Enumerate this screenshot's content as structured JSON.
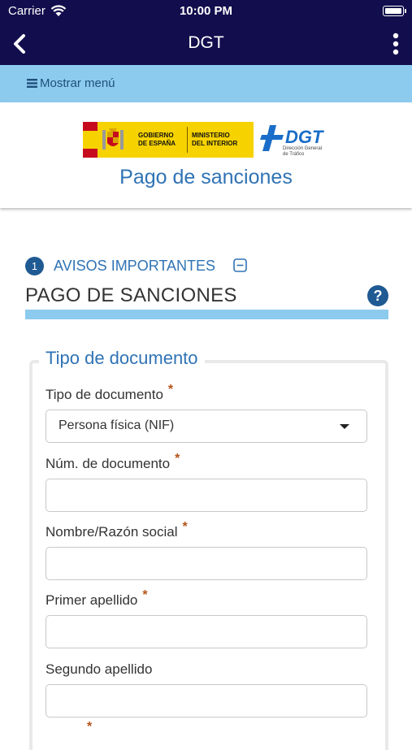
{
  "status_bar": {
    "carrier": "Carrier",
    "time": "10:00 PM"
  },
  "nav": {
    "title": "DGT"
  },
  "menu": {
    "label": "Mostrar menú"
  },
  "header": {
    "gov_logo_line1": "GOBIERNO\nDE ESPAÑA",
    "gov_logo_line2": "MINISTERIO\nDEL INTERIOR",
    "dgt_logo_name": "DGT",
    "dgt_logo_sub": "Dirección General\nde Tráfico",
    "page_title": "Pago de sanciones"
  },
  "step": {
    "number": "1",
    "label": "AVISOS IMPORTANTES"
  },
  "section": {
    "title": "PAGO DE SANCIONES",
    "help": "?"
  },
  "form": {
    "legend": "Tipo de documento",
    "required_mark": "*",
    "fields": [
      {
        "label": "Tipo de documento",
        "required": true,
        "type": "select",
        "value": "Persona física (NIF)"
      },
      {
        "label": "Núm. de documento",
        "required": true,
        "type": "text",
        "value": ""
      },
      {
        "label": "Nombre/Razón social",
        "required": true,
        "type": "text",
        "value": ""
      },
      {
        "label": "Primer apellido",
        "required": true,
        "type": "text",
        "value": ""
      },
      {
        "label": "Segundo apellido",
        "required": false,
        "type": "text",
        "value": ""
      }
    ]
  },
  "colors": {
    "nav_bg": "#120d4d",
    "menu_bg": "#8ccbee",
    "accent_blue": "#2f73b5",
    "step_badge": "#1f5a93",
    "required": "#b4541a"
  }
}
